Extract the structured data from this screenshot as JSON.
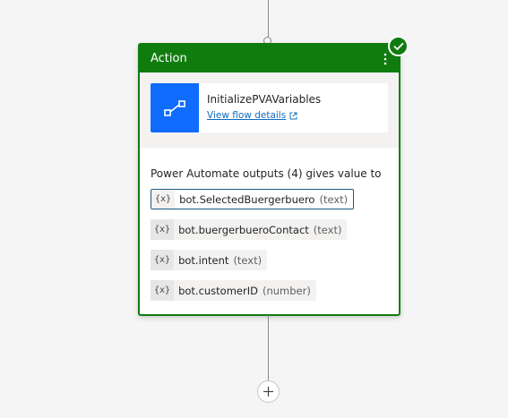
{
  "card": {
    "title": "Action",
    "status": "success",
    "accent_color": "#107c10"
  },
  "flow": {
    "name": "InitializePVAVariables",
    "link_label": "View flow details",
    "icon_color": "#0f6cff"
  },
  "outputs": {
    "label": "Power Automate outputs (4) gives value to",
    "variables": [
      {
        "icon": "{x}",
        "name": "bot.SelectedBuergerbuero",
        "type": "(text)",
        "selected": true
      },
      {
        "icon": "{x}",
        "name": "bot.buergerbueroContact",
        "type": "(text)",
        "selected": false
      },
      {
        "icon": "{x}",
        "name": "bot.intent",
        "type": "(text)",
        "selected": false
      },
      {
        "icon": "{x}",
        "name": "bot.customerID",
        "type": "(number)",
        "selected": false
      }
    ]
  }
}
